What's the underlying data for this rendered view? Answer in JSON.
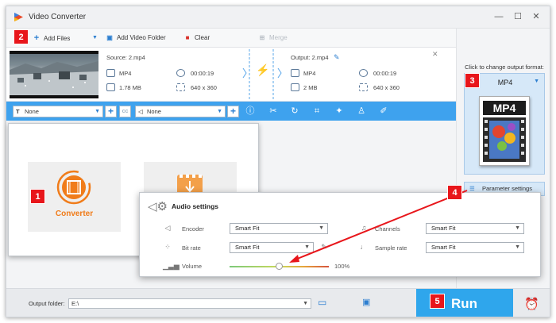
{
  "window": {
    "title": "Video Converter",
    "controls": {
      "minimize": "—",
      "maximize": "☐",
      "close": "✕"
    }
  },
  "toolbar": {
    "add_files": "Add Files",
    "add_video_folder": "Add Video Folder",
    "clear": "Clear",
    "merge": "Merge"
  },
  "file": {
    "source_label": "Source: 2.mp4",
    "output_label": "Output: 2.mp4",
    "source": {
      "format": "MP4",
      "duration": "00:00:19",
      "size": "1.78 MB",
      "resolution": "640 x 360"
    },
    "output": {
      "format": "MP4",
      "duration": "00:00:19",
      "size": "2 MB",
      "resolution": "640 x 360"
    }
  },
  "edit_bar": {
    "subtitle": "None",
    "audio_track": "None"
  },
  "right_pane": {
    "format_hint": "Click to change output format:",
    "format": "MP4",
    "format_icon_text": "MP4",
    "parameter_settings": "Parameter settings"
  },
  "converter_panel": {
    "converter_label": "Converter"
  },
  "audio_settings": {
    "title": "Audio settings",
    "encoder_label": "Encoder",
    "encoder_value": "Smart Fit",
    "bitrate_label": "Bit rate",
    "bitrate_value": "Smart Fit",
    "channels_label": "Channels",
    "channels_value": "Smart Fit",
    "sample_rate_label": "Sample rate",
    "sample_rate_value": "Smart Fit",
    "volume_label": "Volume",
    "volume_value": "100%",
    "volume_level": 0.5
  },
  "footer": {
    "output_folder_label": "Output folder:",
    "output_folder_value": "E:\\",
    "run_label": "Run"
  },
  "badges": [
    "1",
    "2",
    "3",
    "4",
    "5"
  ],
  "colors": {
    "accent": "#3ea2ee",
    "run": "#2fa6ec",
    "badge": "#e8161b",
    "converter_orange": "#f07c1a"
  }
}
